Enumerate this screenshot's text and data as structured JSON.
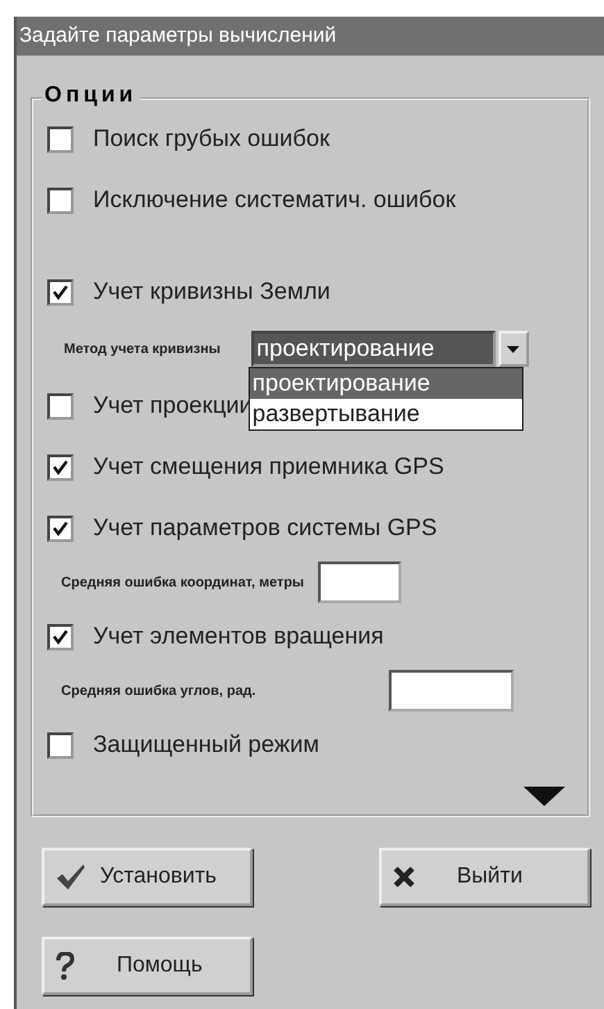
{
  "window": {
    "title": "Задайте параметры вычислений"
  },
  "options": {
    "title": "Опции",
    "sections": [
      [
        {
          "kind": "checkbox",
          "label": "Поиск грубых ошибок",
          "checked": false
        },
        {
          "kind": "checkbox",
          "label": "Исключение систематич. ошибок",
          "checked": false
        }
      ],
      [
        {
          "kind": "checkbox",
          "label": "Учет кривизны Земли",
          "checked": true
        },
        {
          "kind": "select",
          "label": "Метод учета кривизны",
          "value": "проектирование",
          "expanded": true,
          "options": [
            {
              "label": "проектирование",
              "selected": true
            },
            {
              "label": "развертывание",
              "selected": false
            }
          ]
        },
        {
          "kind": "checkbox",
          "label": "Учет проекции",
          "checked": false
        },
        {
          "kind": "checkbox",
          "label": "Учет смещения приемника GPS",
          "checked": true
        },
        {
          "kind": "checkbox",
          "label": "Учет параметров системы GPS",
          "checked": true
        },
        {
          "kind": "field",
          "label": "Средняя ошибка координат, метры"
        },
        {
          "kind": "checkbox",
          "label": "Учет элементов вращения",
          "checked": true
        },
        {
          "kind": "field",
          "label": "Средняя ошибка углов, рад."
        },
        {
          "kind": "checkbox",
          "label": "Защищенный режим",
          "checked": false
        }
      ]
    ]
  },
  "buttons": [
    [
      {
        "label": "Установить"
      },
      {
        "label": "Выйти"
      }
    ],
    [
      {
        "label": "Помощь"
      }
    ]
  ]
}
